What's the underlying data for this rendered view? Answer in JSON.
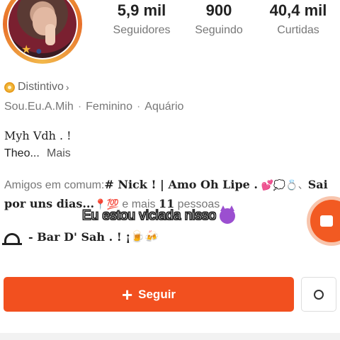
{
  "profile": {
    "stats": [
      {
        "value": "5,9 mil",
        "label": "Seguidores"
      },
      {
        "value": "900",
        "label": "Seguindo"
      },
      {
        "value": "40,4 mil",
        "label": "Curtidas"
      }
    ],
    "badge_label": "Distintivo",
    "badge_chevron": "›",
    "info": {
      "username": "Sou.Eu.A.Mih",
      "sep1": "·",
      "gender": "Feminino",
      "sep2": "·",
      "sign": "Aquário"
    },
    "bio": {
      "line1": "Myh Vdh . !",
      "line2": "Theo...",
      "more": "Mais"
    },
    "mutual": {
      "prefix": "Amigos em comum:",
      "names": "# Nick ! | Amo Oh Lipe .",
      "emojis1": "💕💭💍、",
      "names2": "Sai por uns dias...",
      "emojis2": "📍💯",
      "suffix_pre": " e mais ",
      "count": "11",
      "suffix_post": " pessoas"
    },
    "bar": {
      "text": "- Bar D' Sah . ! ¡",
      "emojis": "🍺🍻"
    }
  },
  "overlay_caption": "Eu estou viciada nisso",
  "actions": {
    "follow_label": "Seguir",
    "follow_plus": "+"
  },
  "colors": {
    "accent": "#f2501f",
    "badge": "#f0b63a",
    "live": "#f25a22"
  },
  "icons": {
    "badge": "badge-icon",
    "more": "ring-icon",
    "live": "live-camera-icon",
    "bar": "dome-icon"
  }
}
